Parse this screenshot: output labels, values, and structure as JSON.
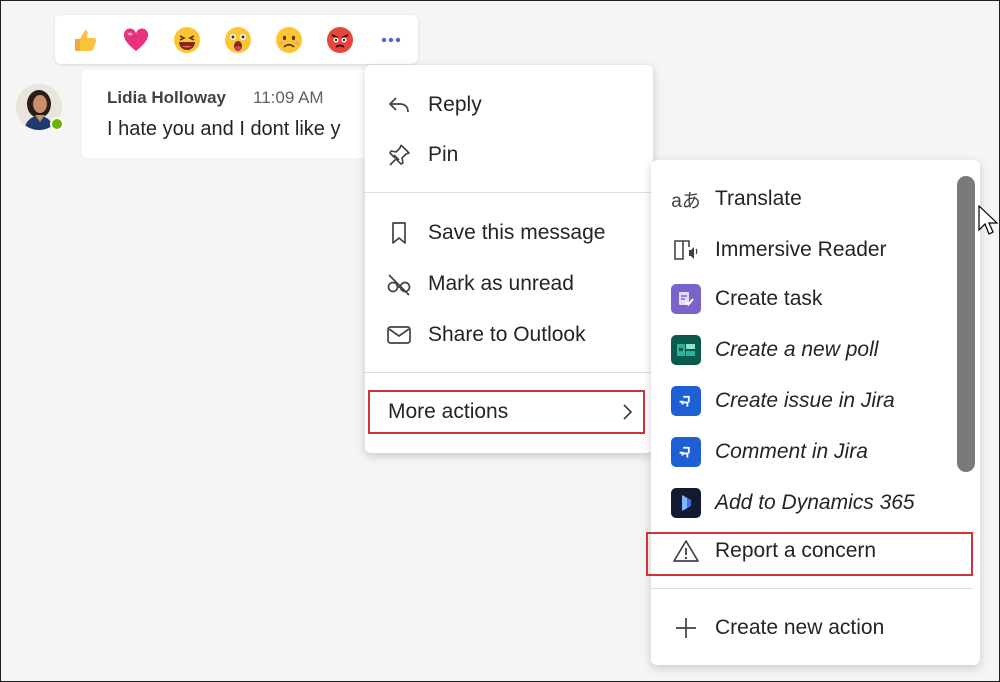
{
  "reactions": [
    {
      "name": "like-emoji-icon"
    },
    {
      "name": "heart-emoji-icon"
    },
    {
      "name": "laugh-emoji-icon"
    },
    {
      "name": "surprised-emoji-icon"
    },
    {
      "name": "sad-emoji-icon"
    },
    {
      "name": "angry-emoji-icon"
    },
    {
      "name": "more-reactions-icon"
    }
  ],
  "message": {
    "sender": "Lidia Holloway",
    "time": "11:09 AM",
    "text": "I hate you and I dont like y"
  },
  "context_menu": {
    "items": [
      {
        "label": "Reply",
        "icon": "reply-icon"
      },
      {
        "label": "Pin",
        "icon": "pin-icon"
      },
      {
        "label": "Save this message",
        "icon": "bookmark-icon"
      },
      {
        "label": "Mark as unread",
        "icon": "mark-unread-icon"
      },
      {
        "label": "Share to Outlook",
        "icon": "mail-icon"
      }
    ],
    "more_actions": "More actions"
  },
  "submenu": {
    "items": [
      {
        "label": "Translate",
        "icon": "translate-icon"
      },
      {
        "label": "Immersive Reader",
        "icon": "immersive-reader-icon"
      },
      {
        "label": "Create task",
        "icon": "planner-task-icon"
      },
      {
        "label": "Create a new poll",
        "icon": "forms-poll-icon"
      },
      {
        "label": "Create issue in Jira",
        "icon": "jira-icon"
      },
      {
        "label": "Comment in Jira",
        "icon": "jira-icon"
      },
      {
        "label": "Add to Dynamics 365",
        "icon": "dynamics-365-icon"
      },
      {
        "label": "Report a concern",
        "icon": "warning-icon"
      },
      {
        "label": "Create new action",
        "icon": "plus-icon"
      }
    ]
  },
  "colors": {
    "highlight_border": "#d13438",
    "presence": "#6bb700",
    "teams_accent": "#5b5fc7"
  }
}
